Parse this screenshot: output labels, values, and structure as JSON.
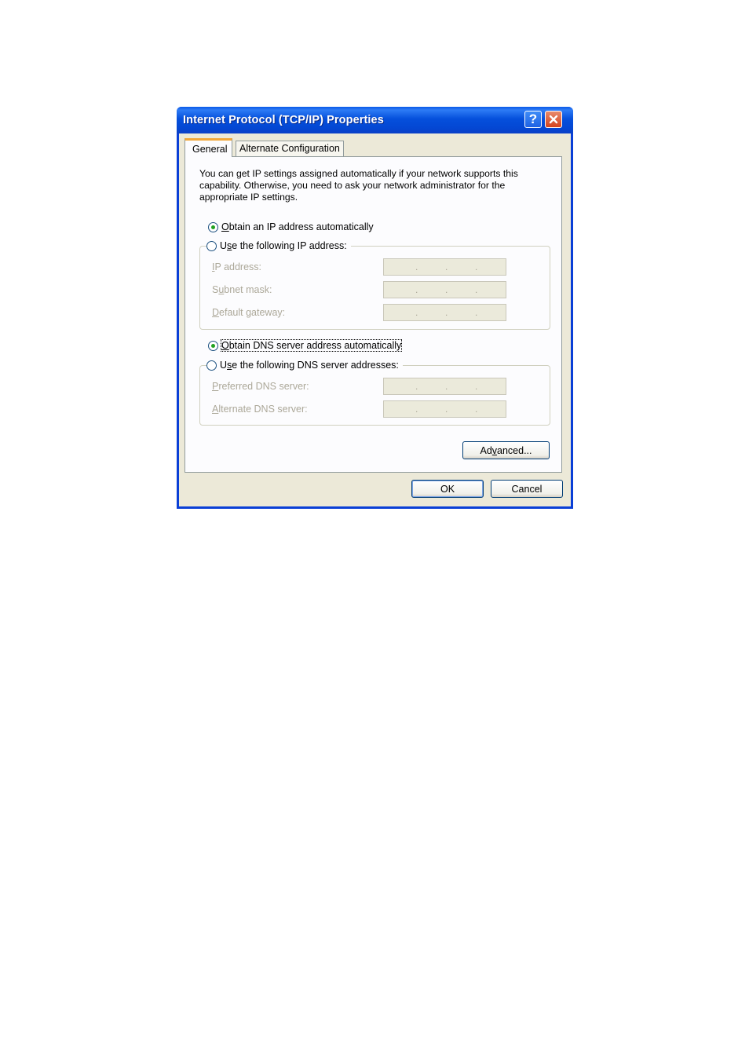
{
  "window": {
    "title": "Internet Protocol (TCP/IP) Properties",
    "help_label": "?",
    "close_label": "✕"
  },
  "tabs": {
    "general": "General",
    "alternate": "Alternate Configuration"
  },
  "intro_text": "You can get IP settings assigned automatically if your network supports this capability. Otherwise, you need to ask your network administrator for the appropriate IP settings.",
  "ip_section": {
    "auto_option": {
      "underline": "O",
      "rest": "btain an IP address automatically",
      "checked": true
    },
    "manual_option": {
      "pre": "U",
      "underline": "s",
      "rest": "e the following IP address:",
      "checked": false
    },
    "fields": [
      {
        "underline": "I",
        "rest": "P address:",
        "value": ". . ."
      },
      {
        "pre": "S",
        "underline": "u",
        "rest": "bnet mask:",
        "value": ". . ."
      },
      {
        "underline": "D",
        "rest": "efault gateway:",
        "value": ". . ."
      }
    ]
  },
  "dns_section": {
    "auto_option": {
      "underline": "O",
      "rest": "btain DNS server address automatically",
      "checked": true
    },
    "manual_option": {
      "pre": "U",
      "underline": "s",
      "rest": "e the following DNS server addresses:",
      "checked": false
    },
    "fields": [
      {
        "underline": "P",
        "rest": "referred DNS server:",
        "value": ". . ."
      },
      {
        "underline": "A",
        "rest": "lternate DNS server:",
        "value": ". . ."
      }
    ]
  },
  "buttons": {
    "advanced": {
      "pre": "Ad",
      "underline": "v",
      "rest": "anced..."
    },
    "ok": "OK",
    "cancel": "Cancel"
  }
}
